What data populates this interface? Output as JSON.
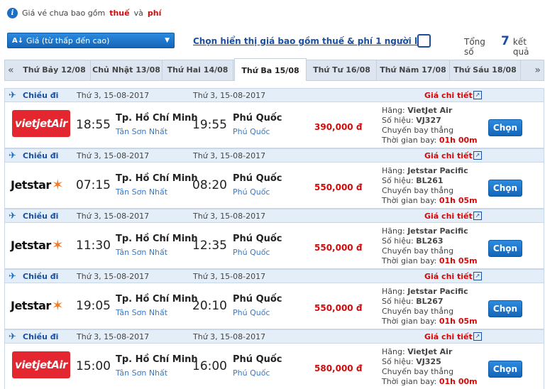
{
  "notice": {
    "prefix": "Giá vé chưa bao gồm",
    "tax": "thuế",
    "and": "và",
    "fee": "phí"
  },
  "sort": {
    "label": "Giá (từ thấp đến cao)",
    "icon": "A↓"
  },
  "include_tax_label": "Chọn hiển thị giá bao gồm thuế & phí 1 người lớn",
  "total": {
    "prefix": "Tổng số",
    "count": "7",
    "suffix": "kết quả"
  },
  "date_tabs": [
    {
      "label": "Thứ Bảy 12/08",
      "active": false
    },
    {
      "label": "Chủ Nhật 13/08",
      "active": false
    },
    {
      "label": "Thứ Hai 14/08",
      "active": false
    },
    {
      "label": "Thứ Ba 15/08",
      "active": true
    },
    {
      "label": "Thứ Tư 16/08",
      "active": false
    },
    {
      "label": "Thứ Năm 17/08",
      "active": false
    },
    {
      "label": "Thứ Sáu 18/08",
      "active": false
    }
  ],
  "labels": {
    "direction": "Chiều đi",
    "detail": "Giá chi tiết",
    "airline_prefix": "Hãng:",
    "flight_no_prefix": "Số hiệu:",
    "flight_type": "Chuyến bay thẳng",
    "duration_prefix": "Thời gian bay:",
    "select": "Chọn"
  },
  "flights": [
    {
      "date_dep": "Thứ 3, 15-08-2017",
      "date_arr": "Thứ 3, 15-08-2017",
      "logo": "vietjet",
      "logo_text": "vietjetAir",
      "dep_time": "18:55",
      "dep_city": "Tp. Hồ Chí Minh",
      "dep_airport": "Tân Sơn Nhất",
      "arr_time": "19:55",
      "arr_city": "Phú Quốc",
      "arr_airport": "Phú Quốc",
      "price": "390,000 đ",
      "airline": "VietJet Air",
      "flight_no": "VJ327",
      "duration": "01h 00m"
    },
    {
      "date_dep": "Thứ 3, 15-08-2017",
      "date_arr": "Thứ 3, 15-08-2017",
      "logo": "jetstar",
      "logo_text": "Jetstar",
      "dep_time": "07:15",
      "dep_city": "Tp. Hồ Chí Minh",
      "dep_airport": "Tân Sơn Nhất",
      "arr_time": "08:20",
      "arr_city": "Phú Quốc",
      "arr_airport": "Phú Quốc",
      "price": "550,000 đ",
      "airline": "Jetstar Pacific",
      "flight_no": "BL261",
      "duration": "01h 05m"
    },
    {
      "date_dep": "Thứ 3, 15-08-2017",
      "date_arr": "Thứ 3, 15-08-2017",
      "logo": "jetstar",
      "logo_text": "Jetstar",
      "dep_time": "11:30",
      "dep_city": "Tp. Hồ Chí Minh",
      "dep_airport": "Tân Sơn Nhất",
      "arr_time": "12:35",
      "arr_city": "Phú Quốc",
      "arr_airport": "Phú Quốc",
      "price": "550,000 đ",
      "airline": "Jetstar Pacific",
      "flight_no": "BL263",
      "duration": "01h 05m"
    },
    {
      "date_dep": "Thứ 3, 15-08-2017",
      "date_arr": "Thứ 3, 15-08-2017",
      "logo": "jetstar",
      "logo_text": "Jetstar",
      "dep_time": "19:05",
      "dep_city": "Tp. Hồ Chí Minh",
      "dep_airport": "Tân Sơn Nhất",
      "arr_time": "20:10",
      "arr_city": "Phú Quốc",
      "arr_airport": "Phú Quốc",
      "price": "550,000 đ",
      "airline": "Jetstar Pacific",
      "flight_no": "BL267",
      "duration": "01h 05m"
    },
    {
      "date_dep": "Thứ 3, 15-08-2017",
      "date_arr": "Thứ 3, 15-08-2017",
      "logo": "vietjet",
      "logo_text": "vietjetAir",
      "dep_time": "15:00",
      "dep_city": "Tp. Hồ Chí Minh",
      "dep_airport": "Tân Sơn Nhất",
      "arr_time": "16:00",
      "arr_city": "Phú Quốc",
      "arr_airport": "Phú Quốc",
      "price": "580,000 đ",
      "airline": "VietJet Air",
      "flight_no": "VJ325",
      "duration": "01h 00m"
    }
  ]
}
